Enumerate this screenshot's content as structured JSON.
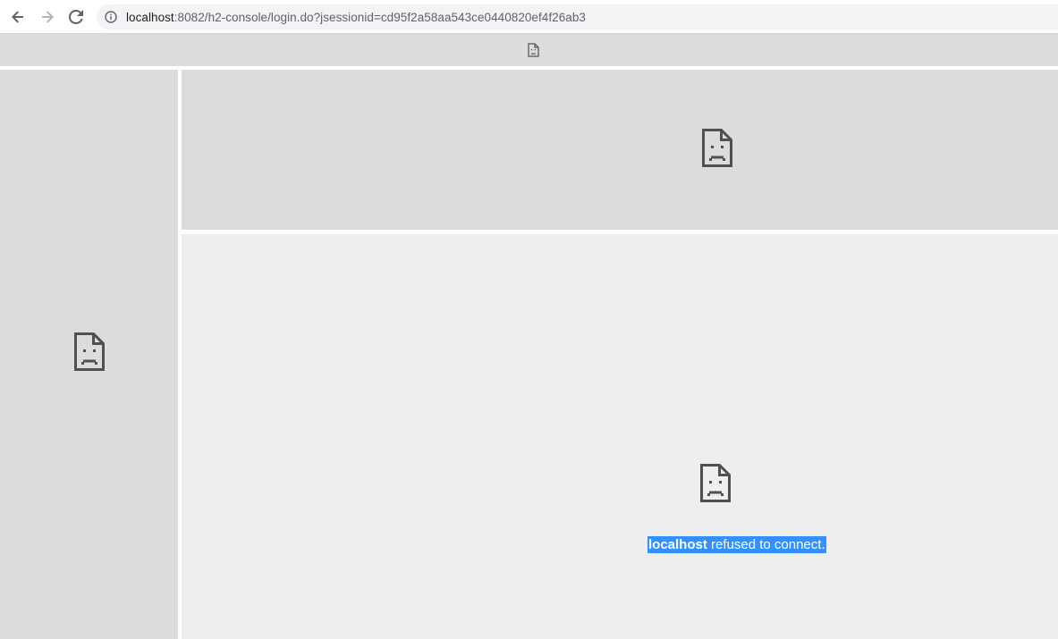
{
  "toolbar": {
    "back_icon": "arrow-left-icon",
    "forward_icon": "arrow-right-icon",
    "reload_icon": "reload-icon",
    "info_icon": "info-circle-icon",
    "url_host": "localhost",
    "url_rest": ":8082/h2-console/login.do?jsessionid=cd95f2a58aa543ce0440820ef4f26ab3"
  },
  "frames": {
    "broken_icon": "sad-page-icon",
    "error": {
      "host": "localhost",
      "text": " refused to connect."
    }
  },
  "colors": {
    "frame_bg": "#dcdcdc",
    "main_bg": "#eeeeee",
    "selection": "#3390ff",
    "icon": "#505050"
  }
}
